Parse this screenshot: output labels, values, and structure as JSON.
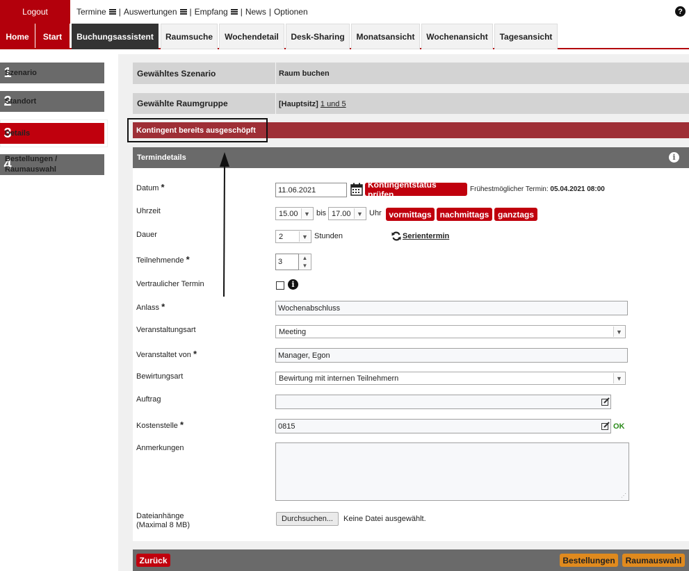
{
  "top": {
    "logout": "Logout",
    "menu": [
      {
        "label": "Termine",
        "has_menu": true
      },
      {
        "label": "Auswertungen",
        "has_menu": true
      },
      {
        "label": "Empfang",
        "has_menu": true
      },
      {
        "label": "News",
        "has_menu": false
      },
      {
        "label": "Optionen",
        "has_menu": false
      }
    ],
    "help_icon": "?"
  },
  "tabs": [
    "Home",
    "Start",
    "Buchungsassistent",
    "Raumsuche",
    "Wochendetail",
    "Desk-Sharing",
    "Monatsansicht",
    "Wochenansicht",
    "Tagesansicht"
  ],
  "steps": [
    {
      "num": "1",
      "label": "Szenario"
    },
    {
      "num": "2",
      "label": "Standort"
    },
    {
      "num": "3",
      "label": "Details"
    },
    {
      "num": "4",
      "label": "Bestellungen / Raumauswahl"
    }
  ],
  "summary": {
    "scenario_key": "Gewähltes Szenario",
    "scenario_value": "Raum buchen",
    "group_key": "Gewählte Raumgruppe",
    "group_bracket": "[Hauptsitz]",
    "group_link": "1 und 5"
  },
  "alert": "Kontingent bereits ausgeschöpft",
  "section_title": "Termindetails",
  "info_icon": "i",
  "form": {
    "datum_label": "Datum",
    "datum_value": "11.06.2021",
    "kontingent_btn": "Kontingentstatus prüfen",
    "earliest_label": "Frühestmöglicher Termin:",
    "earliest_value": "05.04.2021 08:00",
    "uhrzeit_label": "Uhrzeit",
    "uhrzeit_from": "15.00",
    "bis": "bis",
    "uhrzeit_to": "17.00",
    "uhr": "Uhr",
    "vormittags": "vormittags",
    "nachmittags": "nachmittags",
    "ganztags": "ganztags",
    "dauer_label": "Dauer",
    "dauer_value": "2",
    "stunden": "Stunden",
    "serientermin": "Serientermin",
    "teilnehmende_label": "Teilnehmende",
    "teilnehmende_value": "3",
    "vertraulich_label": "Vertraulicher Termin",
    "anlass_label": "Anlass",
    "anlass_value": "Wochenabschluss",
    "veranstaltungsart_label": "Veranstaltungsart",
    "veranstaltungsart_value": "Meeting",
    "veranstaltet_label": "Veranstaltet von",
    "veranstaltet_value": "Manager, Egon",
    "bewirtung_label": "Bewirtungsart",
    "bewirtung_value": "Bewirtung mit internen Teilnehmern",
    "auftrag_label": "Auftrag",
    "auftrag_value": "",
    "kostenstelle_label": "Kostenstelle",
    "kostenstelle_value": "0815",
    "kostenstelle_status": "OK",
    "anmerkungen_label": "Anmerkungen",
    "anmerkungen_value": "",
    "datei_label": "Dateianhänge",
    "datei_sub": "(Maximal 8 MB)",
    "durchsuchen": "Durchsuchen...",
    "keine_datei": "Keine Datei ausgewählt.",
    "required_mark": "*"
  },
  "bottom": {
    "zurueck": "Zurück",
    "bestellungen": "Bestellungen",
    "raumauswahl": "Raumauswahl"
  },
  "colors": {
    "brand_red": "#b3000c",
    "alert_red": "#9e2f36",
    "grey": "#6a6a6a",
    "orange": "#e08a1e",
    "ok_green": "#2a8a1a"
  }
}
